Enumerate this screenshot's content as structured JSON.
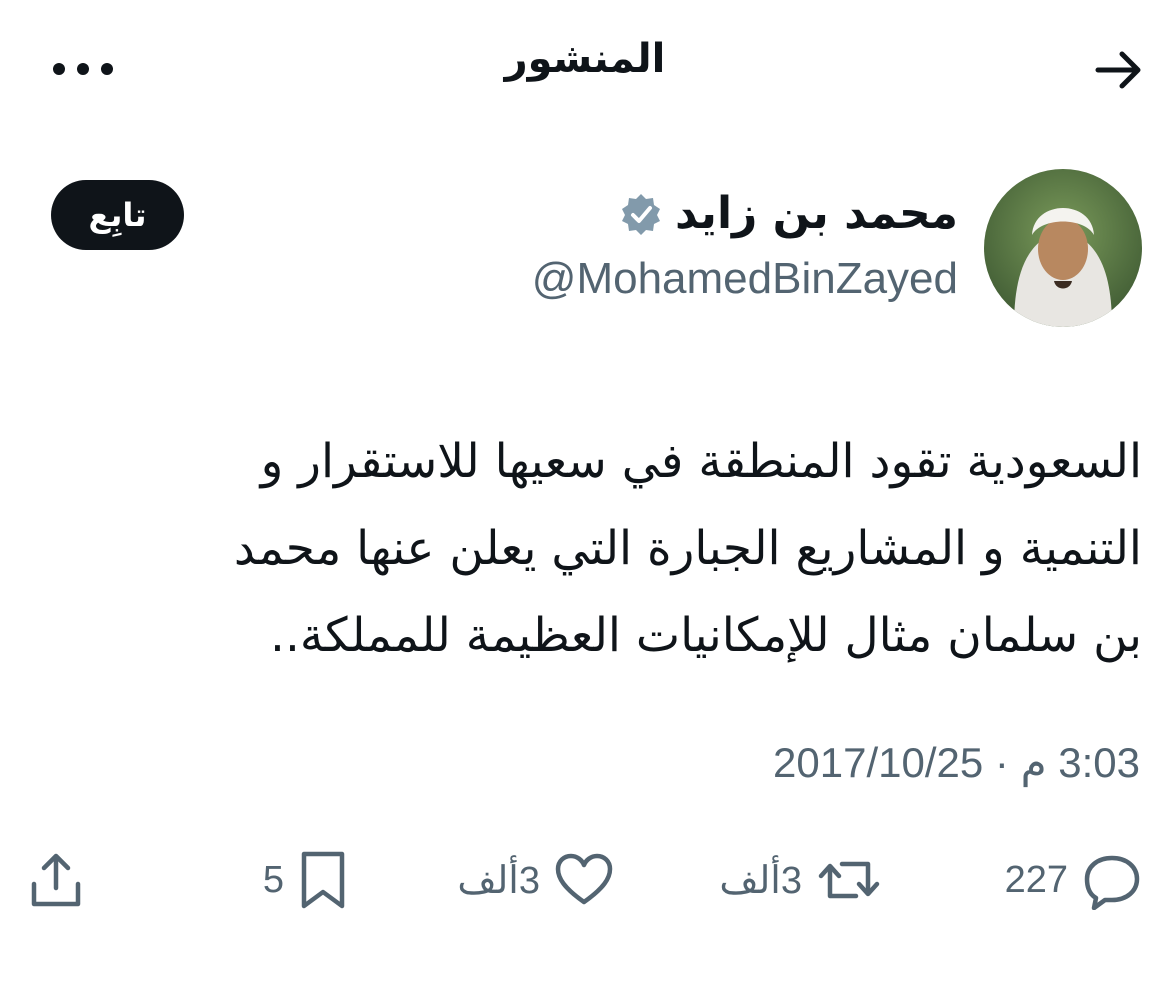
{
  "header": {
    "title": "المنشور",
    "back_icon": "arrow-right-icon",
    "more_icon": "more-horizontal-icon"
  },
  "author": {
    "name": "محمد بن زايد",
    "handle": "@MohamedBinZayed",
    "verified_icon": "verified-badge-icon",
    "follow_label": "تابِع"
  },
  "tweet": {
    "text": "السعودية تقود المنطقة في سعيها للاستقرار و\nالتنمية و المشاريع الجبارة التي يعلن عنها محمد\nبن سلمان مثال للإمكانيات العظيمة للمملكة..",
    "timestamp": "3:03 م · 2017/10/25"
  },
  "actions": {
    "reply_count": "227",
    "retweet_count": "3ألف",
    "like_count": "3ألف",
    "bookmark_count": "5"
  },
  "colors": {
    "text_primary": "#0f1419",
    "text_secondary": "#536471",
    "follow_bg": "#0f1419",
    "verified": "#829aab"
  }
}
